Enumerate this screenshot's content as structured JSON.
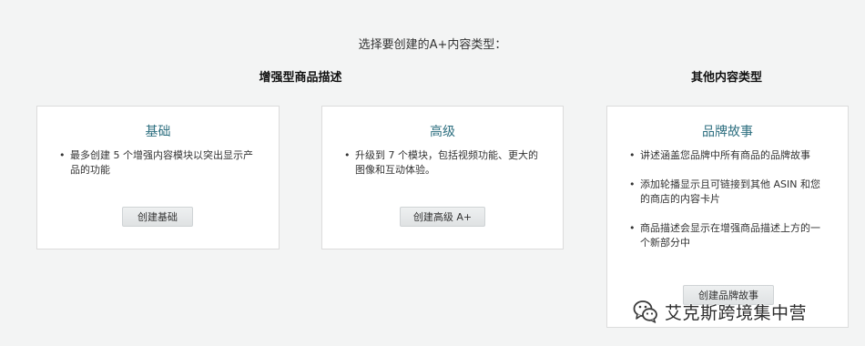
{
  "header": {
    "title": "选择要创建的A+内容类型："
  },
  "sections": {
    "enhanced": "增强型商品描述",
    "other": "其他内容类型"
  },
  "cards": {
    "basic": {
      "title": "基础",
      "bullets": [
        "最多创建 5 个增强内容模块以突出显示产品的功能"
      ],
      "button": "创建基础"
    },
    "premium": {
      "title": "高级",
      "bullets": [
        "升级到 7 个模块，包括视频功能、更大的图像和互动体验。"
      ],
      "button": "创建高级 A+"
    },
    "brand": {
      "title": "品牌故事",
      "bullets": [
        "讲述涵盖您品牌中所有商品的品牌故事",
        "添加轮播显示且可链接到其他 ASIN 和您的商店的内容卡片",
        "商品描述会显示在增强商品描述上方的一个新部分中"
      ],
      "button": "创建品牌故事"
    }
  },
  "watermark": {
    "text": "艾克斯跨境集中营",
    "icon": "wechat-icon"
  }
}
